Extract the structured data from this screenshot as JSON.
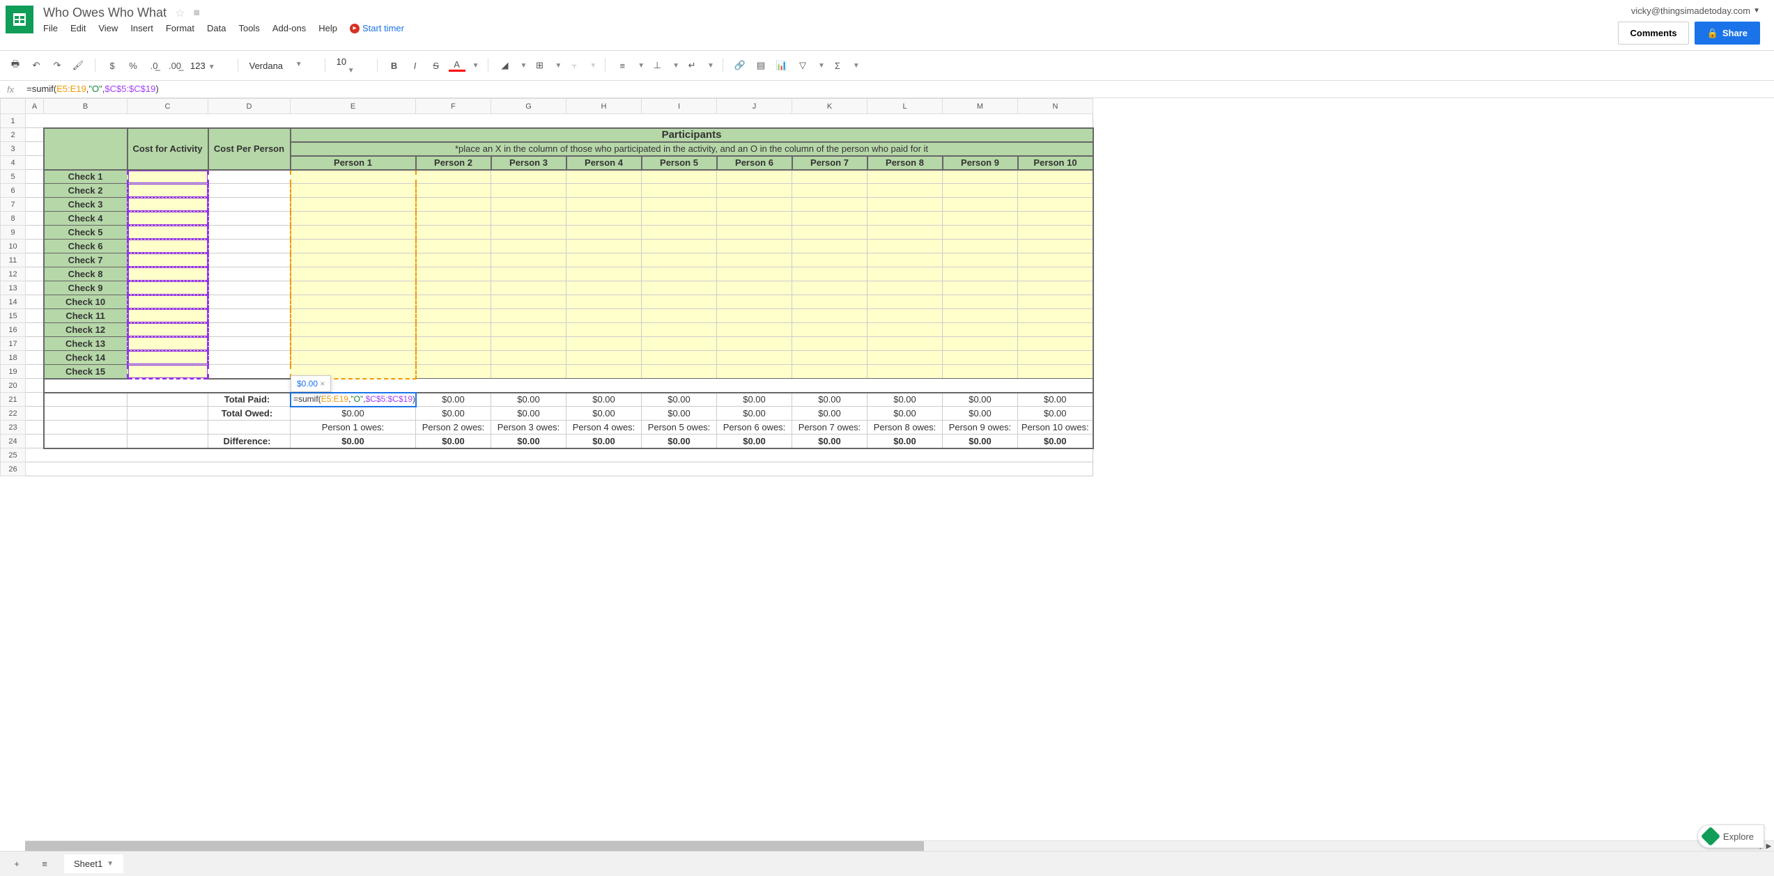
{
  "doc_title": "Who Owes Who What",
  "user_email": "vicky@thingsimadetoday.com",
  "comments_btn": "Comments",
  "share_btn": "Share",
  "menu": {
    "file": "File",
    "edit": "Edit",
    "view": "View",
    "insert": "Insert",
    "format": "Format",
    "data": "Data",
    "tools": "Tools",
    "addons": "Add-ons",
    "help": "Help",
    "start_timer": "Start timer"
  },
  "toolbar": {
    "font": "Verdana",
    "size": "10",
    "num_format": "123"
  },
  "formula": {
    "prefix": "=sumif(",
    "range1": "E5:E19",
    "sep1": ",",
    "str": "\"O\"",
    "sep2": ",",
    "range2": "$C$5:$C$19",
    "suffix": ")"
  },
  "formula_plain": "=sumif(E5:E19,\"O\",$C$5:$C$19)",
  "active_cell_content": "=sumif(E5:E19,\"O\",$C$5:$C$19)",
  "tooltip": "$0.00",
  "columns": [
    "A",
    "B",
    "C",
    "D",
    "E",
    "F",
    "G",
    "H",
    "I",
    "J",
    "K",
    "L",
    "M",
    "N"
  ],
  "rows_visible": 26,
  "headers": {
    "cost_activity": "Cost for Activity",
    "cost_person": "Cost Per Person",
    "participants": "Participants",
    "instruction": "*place an X in the column of those who participated in the activity, and an O in the column of the person who paid for it",
    "persons": [
      "Person 1",
      "Person 2",
      "Person 3",
      "Person 4",
      "Person 5",
      "Person 6",
      "Person 7",
      "Person 8",
      "Person 9",
      "Person 10"
    ]
  },
  "checks": [
    "Check 1",
    "Check 2",
    "Check 3",
    "Check 4",
    "Check 5",
    "Check 6",
    "Check 7",
    "Check 8",
    "Check 9",
    "Check 10",
    "Check 11",
    "Check 12",
    "Check 13",
    "Check 14",
    "Check 15"
  ],
  "totals": {
    "paid_label": "Total Paid:",
    "owed_label": "Total Owed:",
    "diff_label": "Difference:",
    "paid": [
      "$0.00",
      "$0.00",
      "$0.00",
      "$0.00",
      "$0.00",
      "$0.00",
      "$0.00",
      "$0.00",
      "$0.00"
    ],
    "owed": [
      "$0.00",
      "$0.00",
      "$0.00",
      "$0.00",
      "$0.00",
      "$0.00",
      "$0.00",
      "$0.00",
      "$0.00",
      "$0.00"
    ],
    "owes_labels": [
      "Person 1 owes:",
      "Person 2 owes:",
      "Person 3 owes:",
      "Person 4 owes:",
      "Person 5 owes:",
      "Person 6 owes:",
      "Person 7 owes:",
      "Person 8 owes:",
      "Person 9 owes:",
      "Person 10 owes:"
    ],
    "diff": [
      "$0.00",
      "$0.00",
      "$0.00",
      "$0.00",
      "$0.00",
      "$0.00",
      "$0.00",
      "$0.00",
      "$0.00",
      "$0.00"
    ]
  },
  "sheet_tab": "Sheet1",
  "explore": "Explore"
}
